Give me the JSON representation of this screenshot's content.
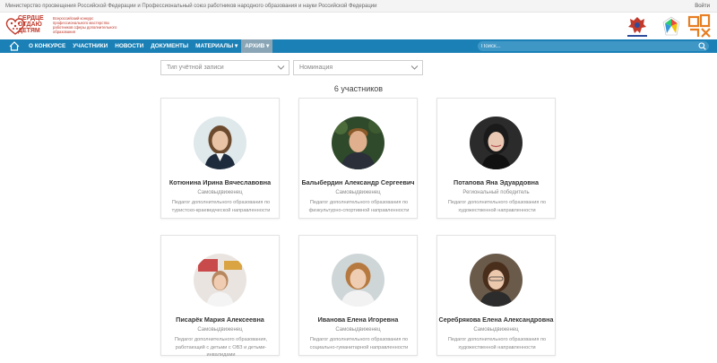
{
  "topbar": {
    "org_text": "Министерство просвещения Российской Федерации и Профессиональный союз работников народного образования и науки Российской Федерации",
    "login_label": "Войти"
  },
  "logo": {
    "title_line1": "Сердце",
    "title_line2": "отдаю",
    "title_line3": "детям",
    "subtitle": "Всероссийский конкурс профессионального мастерства работников сферы дополнительного образования"
  },
  "nav": {
    "items": [
      {
        "label": "О конкурсе"
      },
      {
        "label": "Участники"
      },
      {
        "label": "Новости"
      },
      {
        "label": "Документы"
      },
      {
        "label": "Материалы ▾"
      },
      {
        "label": "Архив ▾",
        "active": true
      }
    ],
    "search_placeholder": "Поиск..."
  },
  "filters": {
    "account_type": "Тип учётной записи",
    "nomination": "Номинация"
  },
  "participants_count": "6 участников",
  "participants": [
    {
      "name": "Котюнина Ирина Вячеславовна",
      "status": "Самовыдвиженец",
      "description": "Педагог дополнительного образования по туристско-краеведческой направленности"
    },
    {
      "name": "Балыбердин Александр Сергеевич",
      "status": "Самовыдвиженец",
      "description": "Педагог дополнительного образования по физкультурно-спортивной направленности"
    },
    {
      "name": "Потапова Яна Эдуардовна",
      "status": "Региональный победитель",
      "description": "Педагог дополнительного образования по художественной направленности"
    },
    {
      "name": "Писарёк Мария Алексеевна",
      "status": "Самовыдвиженец",
      "description": "Педагог дополнительного образования, работающий с детьми с ОВЗ и детьми-инвалидами"
    },
    {
      "name": "Иванова Елена Игоревна",
      "status": "Самовыдвиженец",
      "description": "Педагог дополнительного образования по социально-гуманитарной направленности"
    },
    {
      "name": "Серебрякова Елена Александровна",
      "status": "Самовыдвиженец",
      "description": "Педагог дополнительного образования по художественной направленности"
    }
  ],
  "colors": {
    "nav_bg": "#1a80b6",
    "nav_active": "#8aa6b6",
    "brand_red": "#c0392b"
  }
}
